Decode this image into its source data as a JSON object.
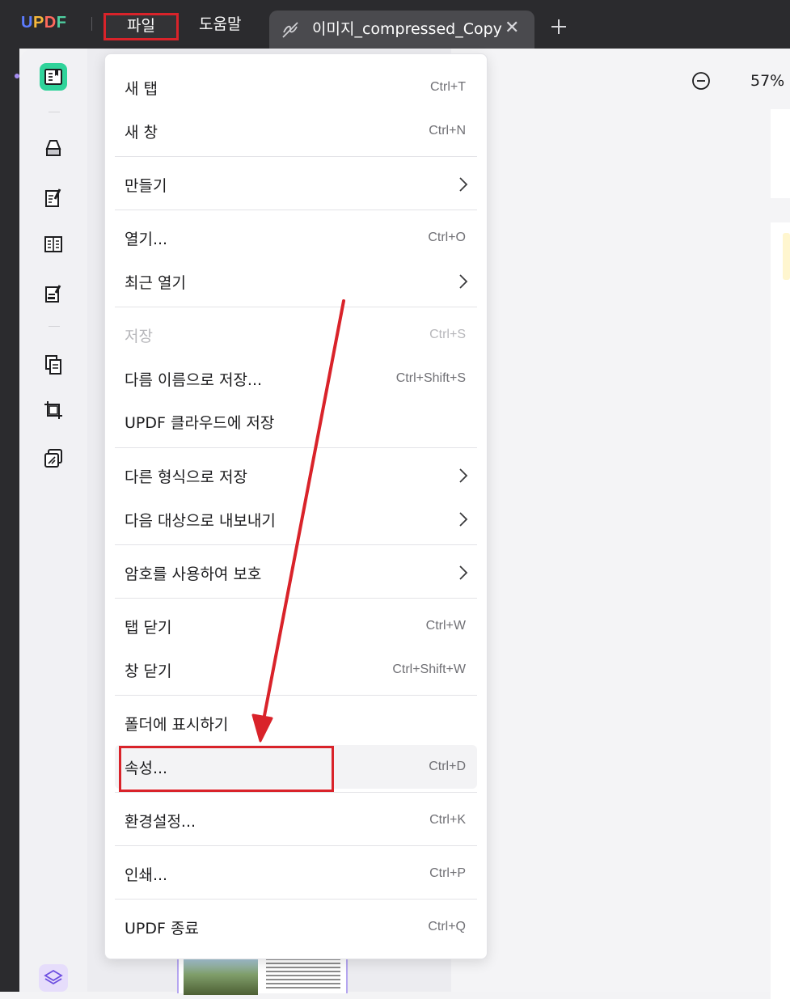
{
  "app": {
    "logo_text": [
      "U",
      "P",
      "D",
      "F"
    ],
    "menubar": {
      "file_label": "파일",
      "help_label": "도움말"
    },
    "tab": {
      "title": "이미지_compressed_Copy",
      "close_glyph": "✕"
    }
  },
  "toolbar": {
    "zoom_level": "57%"
  },
  "sidebar": {
    "icons": [
      "reader-icon",
      "comment-icon",
      "edit-pdf-icon",
      "form-icon",
      "fill-sign-icon",
      "organize-pages-icon",
      "crop-icon",
      "compress-icon",
      "layers-icon"
    ]
  },
  "file_menu": {
    "items": [
      {
        "label": "새 탭",
        "shortcut": "Ctrl+T"
      },
      {
        "label": "새 창",
        "shortcut": "Ctrl+N"
      },
      {
        "label": "만들기",
        "has_submenu": true
      },
      {
        "label": "열기...",
        "shortcut": "Ctrl+O"
      },
      {
        "label": "최근 열기",
        "has_submenu": true
      },
      {
        "label": "저장",
        "shortcut": "Ctrl+S",
        "disabled": true
      },
      {
        "label": "다름 이름으로 저장...",
        "shortcut": "Ctrl+Shift+S"
      },
      {
        "label": "UPDF 클라우드에 저장"
      },
      {
        "label": "다른 형식으로 저장",
        "has_submenu": true
      },
      {
        "label": "다음 대상으로 내보내기",
        "has_submenu": true
      },
      {
        "label": "암호를 사용하여 보호",
        "has_submenu": true
      },
      {
        "label": "탭 닫기",
        "shortcut": "Ctrl+W"
      },
      {
        "label": "창 닫기",
        "shortcut": "Ctrl+Shift+W"
      },
      {
        "label": "폴더에 표시하기"
      },
      {
        "label": "속성...",
        "shortcut": "Ctrl+D",
        "highlighted": true
      },
      {
        "label": "환경설정...",
        "shortcut": "Ctrl+K"
      },
      {
        "label": "인쇄...",
        "shortcut": "Ctrl+P"
      },
      {
        "label": "UPDF 종료",
        "shortcut": "Ctrl+Q"
      }
    ]
  },
  "colors": {
    "titlebar": "#2b2b2e",
    "annotation_red": "#d9232a",
    "active_tool": "#2fd39a",
    "thumbnail_border": "#b5a6f0"
  }
}
